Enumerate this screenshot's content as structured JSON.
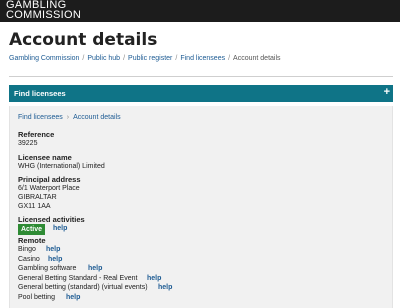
{
  "brand": {
    "line1": "GAMBLING",
    "line2": "COMMISSION"
  },
  "page_title": "Account details",
  "breadcrumb": {
    "items": [
      "Gambling Commission",
      "Public hub",
      "Public register",
      "Find licensees"
    ],
    "current": "Account details",
    "separator": "/"
  },
  "find_bar": {
    "label": "Find licensees",
    "toggle": "+"
  },
  "sub_breadcrumb": {
    "link": "Find licensees",
    "current": "Account details",
    "separator": "›"
  },
  "details": {
    "reference_label": "Reference",
    "reference_value": "39225",
    "licensee_label": "Licensee name",
    "licensee_value": "WHG (International) Limited",
    "address_label": "Principal address",
    "address_lines": [
      "6/1 Waterport Place",
      "GIBRALTAR",
      "GX11 1AA"
    ],
    "activities_label": "Licensed activities",
    "status": "Active",
    "help": "help",
    "remote_label": "Remote",
    "remote_items": [
      "Bingo",
      "Casino",
      "Gambling software",
      "General Betting Standard - Real Event",
      "General betting (standard) (virtual events)",
      "Pool betting"
    ]
  },
  "colors": {
    "topbar": "#1c1c1c",
    "accent": "#0f7487",
    "link": "#1d5b93",
    "active": "#2e8b34"
  }
}
